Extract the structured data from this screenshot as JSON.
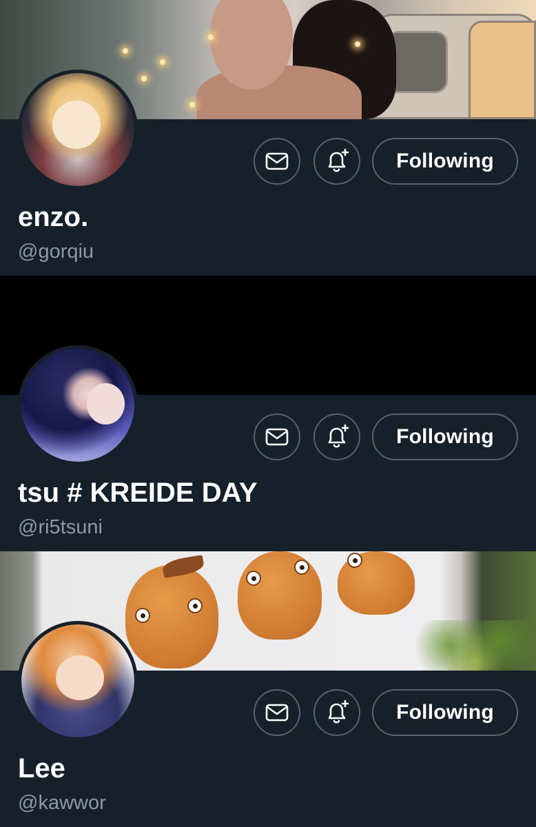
{
  "accent_colors": {
    "background": "#15202b",
    "border": "#536471",
    "handle_text": "#8b98a5",
    "name_text": "#ffffff"
  },
  "profiles": [
    {
      "display_name": "enzo.",
      "handle": "@gorqiu",
      "follow_label": "Following",
      "message_icon": "envelope-icon",
      "notify_icon": "bell-plus-icon"
    },
    {
      "display_name": "tsu # KREIDE DAY",
      "handle": "@ri5tsuni",
      "follow_label": "Following",
      "message_icon": "envelope-icon",
      "notify_icon": "bell-plus-icon"
    },
    {
      "display_name": "Lee",
      "handle": "@kawwor",
      "follow_label": "Following",
      "message_icon": "envelope-icon",
      "notify_icon": "bell-plus-icon"
    }
  ]
}
